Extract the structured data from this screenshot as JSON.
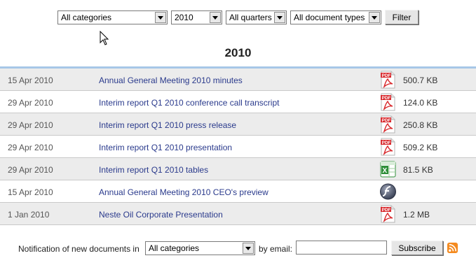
{
  "filters": {
    "category": "All categories",
    "year": "2010",
    "quarter": "All quarters",
    "doc_type": "All document types",
    "filter_label": "Filter"
  },
  "heading": "2010",
  "documents": [
    {
      "date": "15 Apr 2010",
      "title": "Annual General Meeting 2010 minutes",
      "icon": "pdf-icon",
      "size": "500.7 KB"
    },
    {
      "date": "29 Apr 2010",
      "title": "Interim report Q1 2010 conference call transcript",
      "icon": "pdf-icon",
      "size": "124.0 KB"
    },
    {
      "date": "29 Apr 2010",
      "title": "Interim report Q1 2010 press release",
      "icon": "pdf-icon",
      "size": "250.8 KB"
    },
    {
      "date": "29 Apr 2010",
      "title": "Interim report Q1 2010 presentation",
      "icon": "pdf-icon",
      "size": "509.2 KB"
    },
    {
      "date": "29 Apr 2010",
      "title": "Interim report Q1 2010 tables",
      "icon": "excel-icon",
      "size": "81.5 KB"
    },
    {
      "date": "15 Apr 2010",
      "title": "Annual General Meeting 2010 CEO's preview",
      "icon": "flash-icon",
      "size": ""
    },
    {
      "date": "1 Jan 2010",
      "title": "Neste Oil Corporate Presentation",
      "icon": "pdf-icon",
      "size": "1.2 MB"
    }
  ],
  "notification": {
    "label": "Notification of new documents in",
    "category": "All categories",
    "email_label": "by email:",
    "email_value": "",
    "subscribe_label": "Subscribe"
  },
  "colors": {
    "link": "#2a3a8c",
    "row_alt": "#ececec",
    "table_top_border": "#a7c7e7",
    "pdf_red": "#d8262a",
    "excel_green": "#2f8f3a"
  }
}
